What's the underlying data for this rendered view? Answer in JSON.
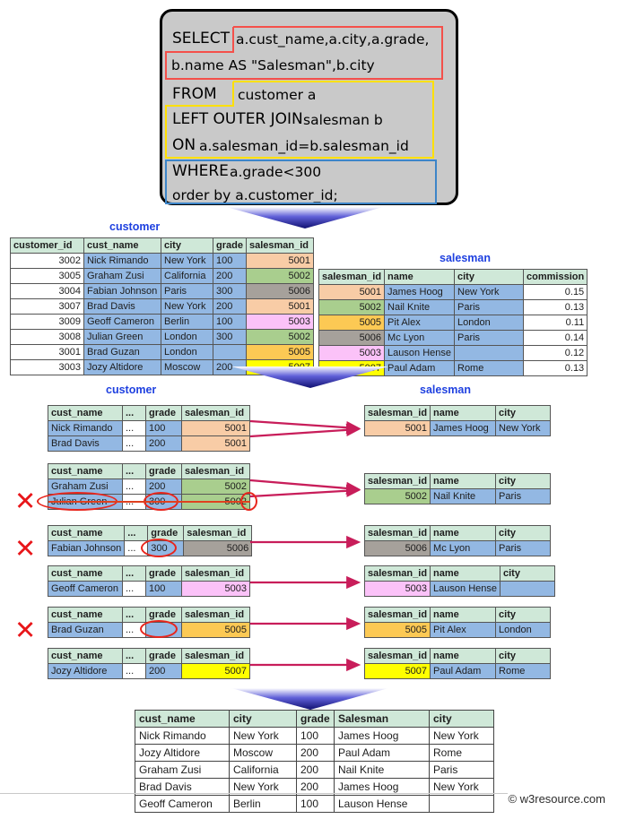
{
  "query": {
    "lines": [
      {
        "keyword": "SELECT",
        "body": "a.cust_name,a.city,a.grade,"
      },
      {
        "keyword": "",
        "body": "b.name AS \"Salesman\",b.city"
      },
      {
        "keyword": "FROM",
        "body": "customer a"
      },
      {
        "keyword": "LEFT OUTER JOIN",
        "body": "salesman b"
      },
      {
        "keyword": "ON",
        "body": "a.salesman_id=b.salesman_id"
      },
      {
        "keyword": "WHERE",
        "body": "a.grade<300"
      },
      {
        "keyword": "",
        "body": "order by a.customer_id;"
      }
    ],
    "select_clause": "SELECT a.cust_name,a.city,a.grade, b.name AS \"Salesman\",b.city",
    "from_clause": "FROM customer a LEFT OUTER JOIN salesman b ON a.salesman_id=b.salesman_id",
    "where_clause": "WHERE a.grade<300 order by a.customer_id;",
    "highlight_colors": {
      "select": "#f4504a",
      "from_join": "#ffe000",
      "where": "#3d85c8"
    }
  },
  "palette": {
    "header_green": "#cfe8d8",
    "row_blue": "#93b8e3",
    "key_5001": "#f8cca6",
    "key_5002": "#a9ce8e",
    "key_5003": "#fbc2f8",
    "key_5005": "#fcc954",
    "key_5006": "#a6a19b",
    "key_5007": "#ffff00",
    "arrow_blue": "#1a1a8c",
    "connector_crimson": "#c81d5a",
    "mark_red": "#e8161a"
  },
  "captions": {
    "customer_top": "customer",
    "salesman_top": "salesman",
    "customer_mid": "customer",
    "salesman_mid": "salesman"
  },
  "customer_table": {
    "title": "customer",
    "columns": [
      "customer_id",
      "cust_name",
      "city",
      "grade",
      "salesman_id"
    ],
    "rows": [
      {
        "customer_id": "3002",
        "cust_name": "Nick Rimando",
        "city": "New York",
        "grade": "100",
        "salesman_id": "5001"
      },
      {
        "customer_id": "3005",
        "cust_name": "Graham Zusi",
        "city": "California",
        "grade": "200",
        "salesman_id": "5002"
      },
      {
        "customer_id": "3004",
        "cust_name": "Fabian Johnson",
        "city": "Paris",
        "grade": "300",
        "salesman_id": "5006"
      },
      {
        "customer_id": "3007",
        "cust_name": "Brad Davis",
        "city": "New York",
        "grade": "200",
        "salesman_id": "5001"
      },
      {
        "customer_id": "3009",
        "cust_name": "Geoff Cameron",
        "city": "Berlin",
        "grade": "100",
        "salesman_id": "5003"
      },
      {
        "customer_id": "3008",
        "cust_name": "Julian Green",
        "city": "London",
        "grade": "300",
        "salesman_id": "5002"
      },
      {
        "customer_id": "3001",
        "cust_name": "Brad Guzan",
        "city": "London",
        "grade": "",
        "salesman_id": "5005"
      },
      {
        "customer_id": "3003",
        "cust_name": "Jozy Altidore",
        "city": "Moscow",
        "grade": "200",
        "salesman_id": "5007"
      }
    ]
  },
  "salesman_table": {
    "title": "salesman",
    "columns": [
      "salesman_id",
      "name",
      "city",
      "commission"
    ],
    "rows": [
      {
        "salesman_id": "5001",
        "name": "James Hoog",
        "city": "New York",
        "commission": "0.15"
      },
      {
        "salesman_id": "5002",
        "name": "Nail Knite",
        "city": "Paris",
        "commission": "0.13"
      },
      {
        "salesman_id": "5005",
        "name": "Pit Alex",
        "city": "London",
        "commission": "0.11"
      },
      {
        "salesman_id": "5006",
        "name": "Mc Lyon",
        "city": "Paris",
        "commission": "0.14"
      },
      {
        "salesman_id": "5003",
        "name": "Lauson Hense",
        "city": "",
        "commission": "0.12"
      },
      {
        "salesman_id": "5007",
        "name": "Paul Adam",
        "city": "Rome",
        "commission": "0.13"
      }
    ]
  },
  "join_groups": {
    "customer_columns": [
      "cust_name",
      "...",
      "grade",
      "salesman_id"
    ],
    "salesman_columns": [
      "salesman_id",
      "name",
      "city"
    ],
    "groups": [
      {
        "customer_rows": [
          {
            "cust_name": "Nick Rimando",
            "dots": "...",
            "grade": "100",
            "salesman_id": "5001",
            "excluded": false
          },
          {
            "cust_name": "Brad Davis",
            "dots": "...",
            "grade": "200",
            "salesman_id": "5001",
            "excluded": false
          }
        ],
        "salesman_row": {
          "salesman_id": "5001",
          "name": "James Hoog",
          "city": "New York"
        },
        "key_color": "#f8cca6"
      },
      {
        "customer_rows": [
          {
            "cust_name": "Graham Zusi",
            "dots": "...",
            "grade": "200",
            "salesman_id": "5002",
            "excluded": false
          },
          {
            "cust_name": "Julian Green",
            "dots": "...",
            "grade": "300",
            "salesman_id": "5002",
            "excluded": true
          }
        ],
        "salesman_row": {
          "salesman_id": "5002",
          "name": "Nail Knite",
          "city": "Paris"
        },
        "key_color": "#a9ce8e"
      },
      {
        "customer_rows": [
          {
            "cust_name": "Fabian Johnson",
            "dots": "...",
            "grade": "300",
            "salesman_id": "5006",
            "excluded": true
          }
        ],
        "salesman_row": {
          "salesman_id": "5006",
          "name": "Mc Lyon",
          "city": "Paris"
        },
        "key_color": "#a6a19b"
      },
      {
        "customer_rows": [
          {
            "cust_name": "Geoff Cameron",
            "dots": "...",
            "grade": "100",
            "salesman_id": "5003",
            "excluded": false
          }
        ],
        "salesman_row": {
          "salesman_id": "5003",
          "name": "Lauson Hense",
          "city": ""
        },
        "key_color": "#fbc2f8"
      },
      {
        "customer_rows": [
          {
            "cust_name": "Brad Guzan",
            "dots": "...",
            "grade": "",
            "salesman_id": "5005",
            "excluded": true
          }
        ],
        "salesman_row": {
          "salesman_id": "5005",
          "name": "Pit Alex",
          "city": "London"
        },
        "key_color": "#fcc954"
      },
      {
        "customer_rows": [
          {
            "cust_name": "Jozy Altidore",
            "dots": "...",
            "grade": "200",
            "salesman_id": "5007",
            "excluded": false
          }
        ],
        "salesman_row": {
          "salesman_id": "5007",
          "name": "Paul Adam",
          "city": "Rome"
        },
        "key_color": "#ffff00"
      }
    ]
  },
  "result_table": {
    "columns": [
      "cust_name",
      "city",
      "grade",
      "Salesman",
      "city"
    ],
    "rows": [
      {
        "cust_name": "Nick Rimando",
        "city": "New York",
        "grade": "100",
        "salesman": "James Hoog",
        "salesman_city": "New York"
      },
      {
        "cust_name": "Jozy Altidore",
        "city": "Moscow",
        "grade": "200",
        "salesman": "Paul Adam",
        "salesman_city": "Rome"
      },
      {
        "cust_name": "Graham Zusi",
        "city": "California",
        "grade": "200",
        "salesman": "Nail Knite",
        "salesman_city": "Paris"
      },
      {
        "cust_name": "Brad Davis",
        "city": "New York",
        "grade": "200",
        "salesman": "James Hoog",
        "salesman_city": "New York"
      },
      {
        "cust_name": "Geoff Cameron",
        "city": "Berlin",
        "grade": "100",
        "salesman": "Lauson Hense",
        "salesman_city": ""
      }
    ]
  },
  "footer": {
    "watermark": "© w3resource.com"
  }
}
